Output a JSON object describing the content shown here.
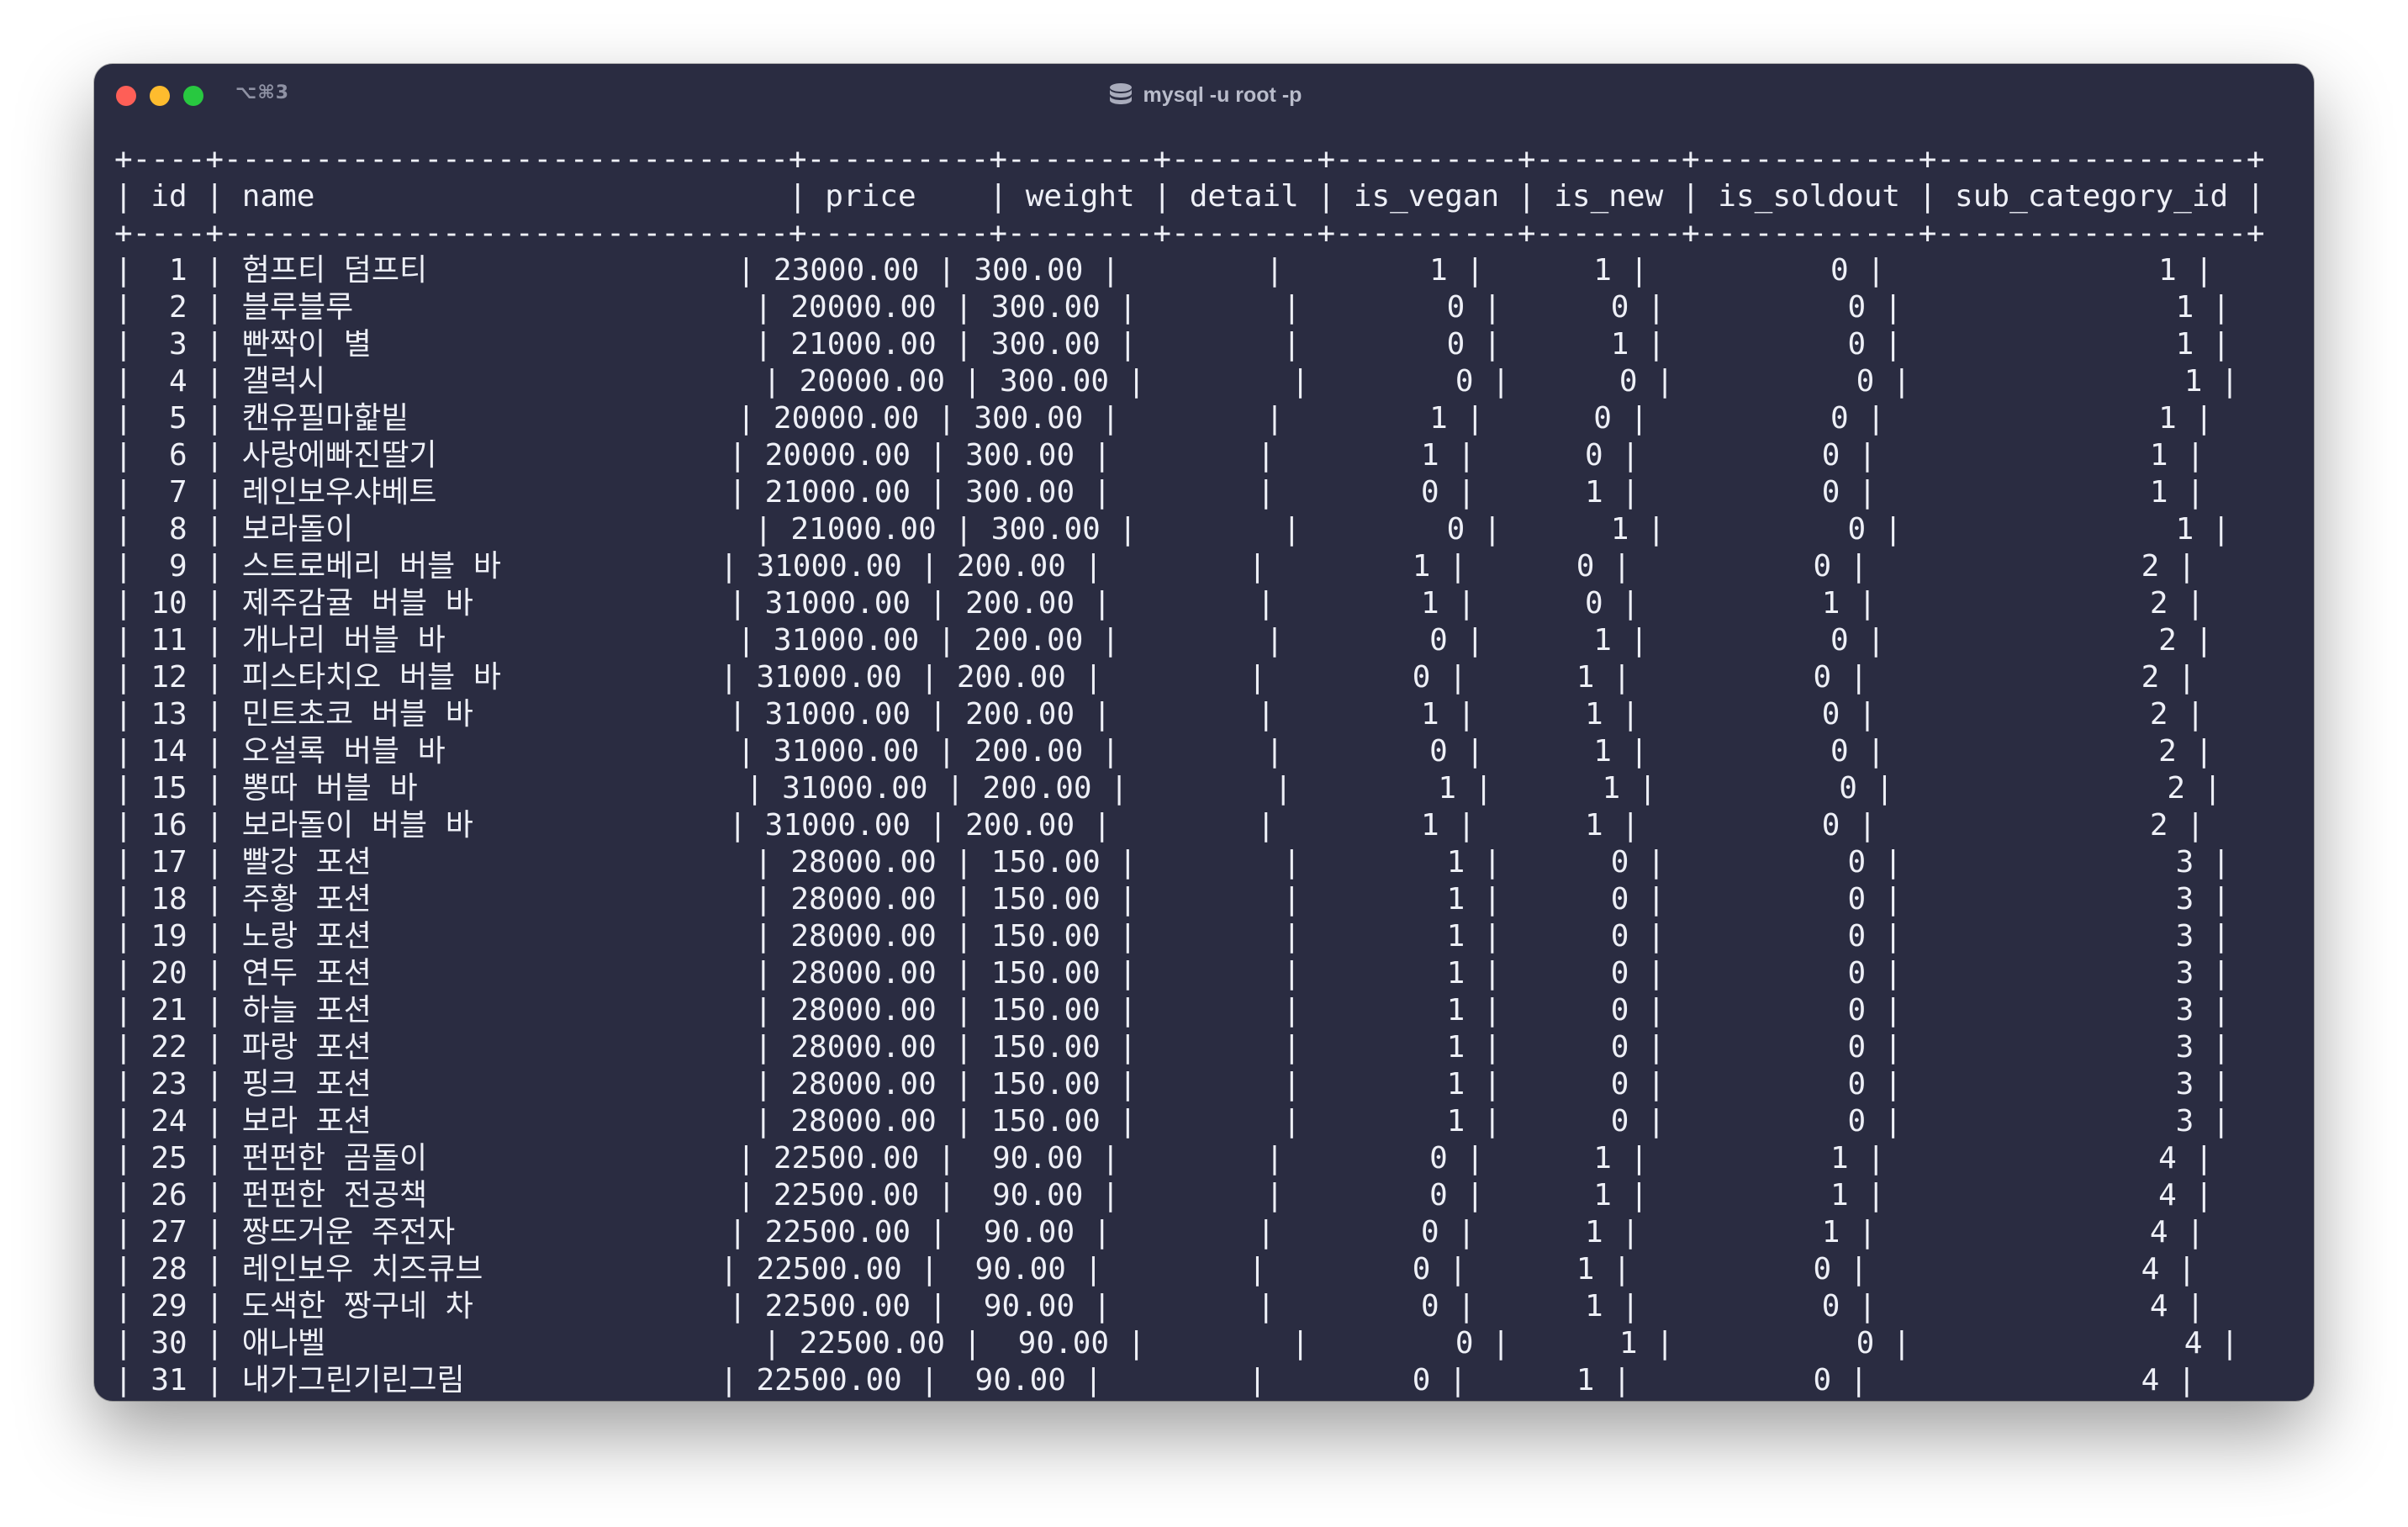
{
  "window": {
    "shortcut": "⌥⌘3",
    "title": "mysql -u root -p"
  },
  "table": {
    "columns": [
      "id",
      "name",
      "price",
      "weight",
      "detail",
      "is_vegan",
      "is_new",
      "is_soldout",
      "sub_category_id"
    ],
    "rows": [
      [
        "1",
        "험프티 덤프티",
        "23000.00",
        "300.00",
        "",
        "1",
        "1",
        "0",
        "1"
      ],
      [
        "2",
        "블루블루",
        "20000.00",
        "300.00",
        "",
        "0",
        "0",
        "0",
        "1"
      ],
      [
        "3",
        "빤짝이 별",
        "21000.00",
        "300.00",
        "",
        "0",
        "1",
        "0",
        "1"
      ],
      [
        "4",
        "갤럭시",
        "20000.00",
        "300.00",
        "",
        "0",
        "0",
        "0",
        "1"
      ],
      [
        "5",
        "캔유필마핥빝",
        "20000.00",
        "300.00",
        "",
        "1",
        "0",
        "0",
        "1"
      ],
      [
        "6",
        "사랑에빠진딸기",
        "20000.00",
        "300.00",
        "",
        "1",
        "0",
        "0",
        "1"
      ],
      [
        "7",
        "레인보우샤베트",
        "21000.00",
        "300.00",
        "",
        "0",
        "1",
        "0",
        "1"
      ],
      [
        "8",
        "보라돌이",
        "21000.00",
        "300.00",
        "",
        "0",
        "1",
        "0",
        "1"
      ],
      [
        "9",
        "스트로베리 버블 바",
        "31000.00",
        "200.00",
        "",
        "1",
        "0",
        "0",
        "2"
      ],
      [
        "10",
        "제주감귤 버블 바",
        "31000.00",
        "200.00",
        "",
        "1",
        "0",
        "1",
        "2"
      ],
      [
        "11",
        "개나리 버블 바",
        "31000.00",
        "200.00",
        "",
        "0",
        "1",
        "0",
        "2"
      ],
      [
        "12",
        "피스타치오 버블 바",
        "31000.00",
        "200.00",
        "",
        "0",
        "1",
        "0",
        "2"
      ],
      [
        "13",
        "민트초코 버블 바",
        "31000.00",
        "200.00",
        "",
        "1",
        "1",
        "0",
        "2"
      ],
      [
        "14",
        "오설록 버블 바",
        "31000.00",
        "200.00",
        "",
        "0",
        "1",
        "0",
        "2"
      ],
      [
        "15",
        "뽕따 버블 바",
        "31000.00",
        "200.00",
        "",
        "1",
        "1",
        "0",
        "2"
      ],
      [
        "16",
        "보라돌이 버블 바",
        "31000.00",
        "200.00",
        "",
        "1",
        "1",
        "0",
        "2"
      ],
      [
        "17",
        "빨강 포션",
        "28000.00",
        "150.00",
        "",
        "1",
        "0",
        "0",
        "3"
      ],
      [
        "18",
        "주황 포션",
        "28000.00",
        "150.00",
        "",
        "1",
        "0",
        "0",
        "3"
      ],
      [
        "19",
        "노랑 포션",
        "28000.00",
        "150.00",
        "",
        "1",
        "0",
        "0",
        "3"
      ],
      [
        "20",
        "연두 포션",
        "28000.00",
        "150.00",
        "",
        "1",
        "0",
        "0",
        "3"
      ],
      [
        "21",
        "하늘 포션",
        "28000.00",
        "150.00",
        "",
        "1",
        "0",
        "0",
        "3"
      ],
      [
        "22",
        "파랑 포션",
        "28000.00",
        "150.00",
        "",
        "1",
        "0",
        "0",
        "3"
      ],
      [
        "23",
        "핑크 포션",
        "28000.00",
        "150.00",
        "",
        "1",
        "0",
        "0",
        "3"
      ],
      [
        "24",
        "보라 포션",
        "28000.00",
        "150.00",
        "",
        "1",
        "0",
        "0",
        "3"
      ],
      [
        "25",
        "펀펀한 곰돌이",
        "22500.00",
        "90.00",
        "",
        "0",
        "1",
        "1",
        "4"
      ],
      [
        "26",
        "펀펀한 전공책",
        "22500.00",
        "90.00",
        "",
        "0",
        "1",
        "1",
        "4"
      ],
      [
        "27",
        "짱뜨거운 주전자",
        "22500.00",
        "90.00",
        "",
        "0",
        "1",
        "1",
        "4"
      ],
      [
        "28",
        "레인보우 치즈큐브",
        "22500.00",
        "90.00",
        "",
        "0",
        "1",
        "0",
        "4"
      ],
      [
        "29",
        "도색한 짱구네 차",
        "22500.00",
        "90.00",
        "",
        "0",
        "1",
        "0",
        "4"
      ],
      [
        "30",
        "애나벨",
        "22500.00",
        "90.00",
        "",
        "0",
        "1",
        "0",
        "4"
      ],
      [
        "31",
        "내가그린기린그림",
        "22500.00",
        "90.00",
        "",
        "0",
        "1",
        "0",
        "4"
      ]
    ]
  }
}
